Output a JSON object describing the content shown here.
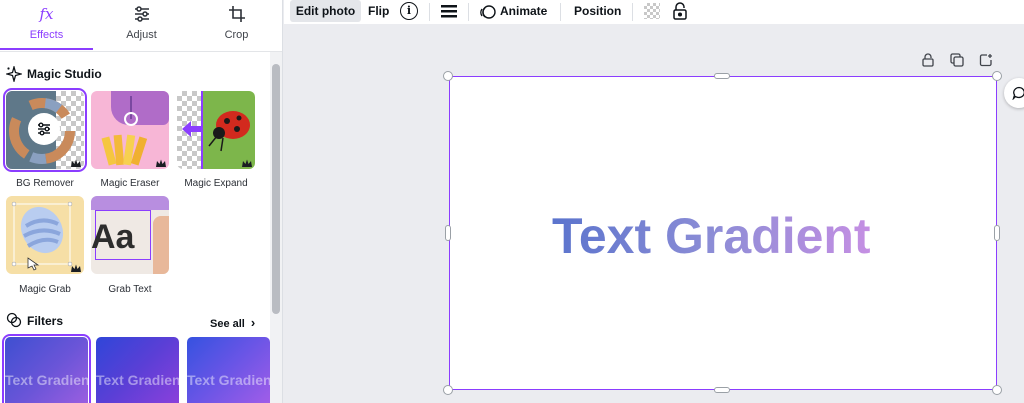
{
  "tabs": [
    {
      "label": "Effects",
      "icon": "fx-icon",
      "active": true
    },
    {
      "label": "Adjust",
      "icon": "sliders-icon",
      "active": false
    },
    {
      "label": "Crop",
      "icon": "crop-icon",
      "active": false
    }
  ],
  "tabs_fx_glyph": "fx",
  "magic_studio": {
    "title": "Magic Studio",
    "tools": [
      {
        "label": "BG Remover",
        "premium": true
      },
      {
        "label": "Magic Eraser",
        "premium": true
      },
      {
        "label": "Magic Expand",
        "premium": true
      },
      {
        "label": "Magic Grab",
        "premium": true
      },
      {
        "label": "Grab Text",
        "premium": false
      }
    ],
    "grab_text_sample": "Aa"
  },
  "filters": {
    "title": "Filters",
    "see_all": "See all",
    "see_all_chevron": "›",
    "preview_text": "Text Gradient"
  },
  "toolbar": {
    "edit_photo": "Edit photo",
    "flip": "Flip",
    "animate": "Animate",
    "position": "Position",
    "info_glyph": "i"
  },
  "canvas": {
    "text": "Text Gradient"
  },
  "colors": {
    "accent": "#8b3dff",
    "gradient_start": "#5b74cd",
    "gradient_end": "#c58fe3"
  }
}
